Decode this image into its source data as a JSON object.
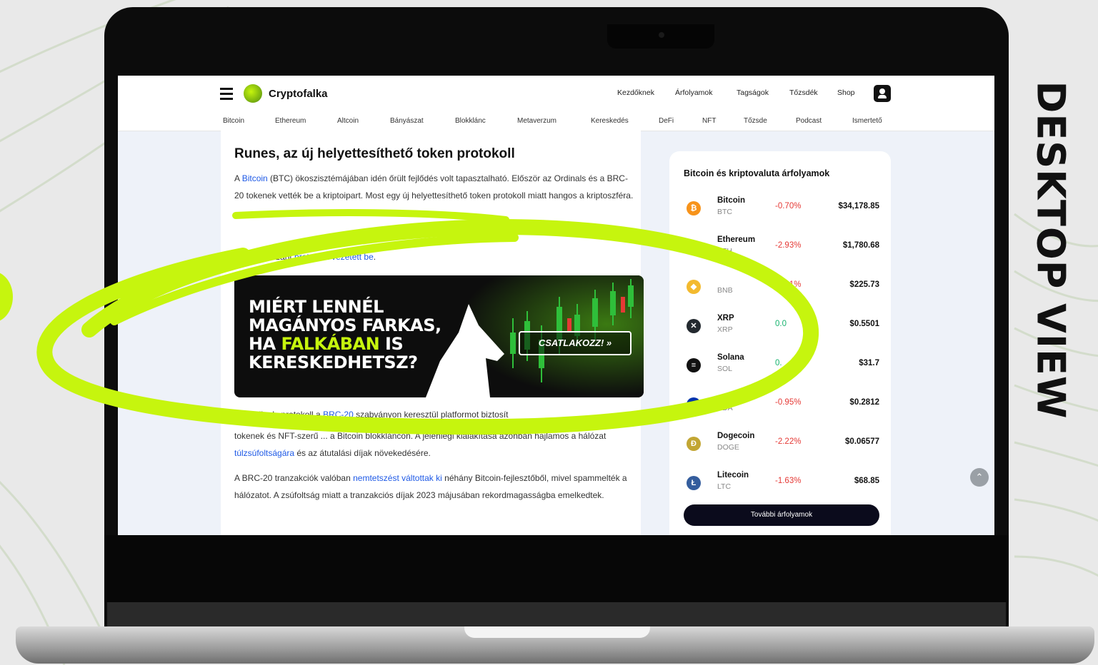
{
  "side_label": "DESKTOP VIEW",
  "colors": {
    "accent": "#c6f50e",
    "link": "#1f5ae6",
    "negative": "#e53935",
    "positive": "#16b36e"
  },
  "site": {
    "logo_text": "Cryptofalka",
    "top_nav": [
      "Kezdőknek",
      "Árfolyamok",
      "Tagságok",
      "Tőzsdék",
      "Shop"
    ],
    "categories": [
      "Bitcoin",
      "Ethereum",
      "Altcoin",
      "Bányászat",
      "Blokklánc",
      "Metaverzum",
      "Kereskedés",
      "DeFi",
      "NFT",
      "Tőzsde",
      "Podcast",
      "Ismertető"
    ]
  },
  "article": {
    "title": "Runes, az új helyettesíthető token protokoll",
    "p1_a": "A ",
    "p1_link": "Bitcoin",
    "p1_b": " (BTC) ökoszisztémájában idén őrült fejlődés volt tapasztalható. Először az Ordinals és a BRC-20 tokenek vették be a kriptoipart. Most egy új helyettesíthető token protokoll miatt hangos a kriptoszféra.",
    "p2_a": "...neknek szánt ",
    "p2_link": "protokollt vezetett be",
    "p2_b": ".",
    "p3_a": "Az Ordinals protokoll a ",
    "p3_link": "BRC-20",
    "p3_b": " szabványon keresztül platformot biztosít",
    "p4_a": "tokenek és NFT-szerű ... a Bitcoin blokkláncon. A jelenlegi kialakítása azonban hajlamos a hálózat ",
    "p4_link": "túlzsúfoltságára",
    "p4_b": " és az átutalási díjak növekedésére.",
    "p5_a": "A BRC-20 tranzakciók valóban ",
    "p5_link": "nemtetszést váltottak ki",
    "p5_b": " néhány Bitcoin-fejlesztőből, mivel spammelték a hálózatot. A zsúfoltság miatt a tranzakciós díjak 2023 májusában rekordmagasságba emelkedtek."
  },
  "banner": {
    "line1": "MIÉRT LENNÉL",
    "line2": "MAGÁNYOS FARKAS,",
    "line3_a": "HA ",
    "line3_b": "FALKÁBAN",
    "line3_c": " IS",
    "line4": "KERESKEDHETSZ?",
    "cta": "CSATLAKOZZ! »"
  },
  "prices": {
    "title": "Bitcoin és kriptovaluta árfolyamok",
    "coins": [
      {
        "name": "Bitcoin",
        "symbol": "BTC",
        "change": "-0.70%",
        "price": "$34,178.85",
        "color": "#f7931a",
        "icon": "bitcoin-icon",
        "glyph": "₿",
        "trend": "down"
      },
      {
        "name": "Ethereum",
        "symbol": "ETH",
        "change": "-2.93%",
        "price": "$1,780.68",
        "color": "#ffffff",
        "icon": "ethereum-icon",
        "glyph": "♦",
        "trend": "down"
      },
      {
        "name": "",
        "symbol": "BNB",
        "change": "-1.81%",
        "price": "$225.73",
        "color": "#f3ba2f",
        "icon": "bnb-icon",
        "glyph": "◆",
        "trend": "down"
      },
      {
        "name": "XRP",
        "symbol": "XRP",
        "change": "0.0",
        "price": "$0.5501",
        "color": "#23292f",
        "icon": "xrp-icon",
        "glyph": "✕",
        "trend": "up"
      },
      {
        "name": "Solana",
        "symbol": "SOL",
        "change": "0.",
        "price": "$31.7",
        "color": "#111111",
        "icon": "solana-icon",
        "glyph": "≡",
        "trend": "up"
      },
      {
        "name": "",
        "symbol": "ADA",
        "change": "-0.95%",
        "price": "$0.2812",
        "color": "#0033ad",
        "icon": "cardano-icon",
        "glyph": "",
        "trend": "down"
      },
      {
        "name": "Dogecoin",
        "symbol": "DOGE",
        "change": "-2.22%",
        "price": "$0.06577",
        "color": "#c2a633",
        "icon": "dogecoin-icon",
        "glyph": "Ð",
        "trend": "down"
      },
      {
        "name": "Litecoin",
        "symbol": "LTC",
        "change": "-1.63%",
        "price": "$68.85",
        "color": "#345d9d",
        "icon": "litecoin-icon",
        "glyph": "Ł",
        "trend": "down"
      }
    ],
    "more_button": "További árfolyamok"
  }
}
